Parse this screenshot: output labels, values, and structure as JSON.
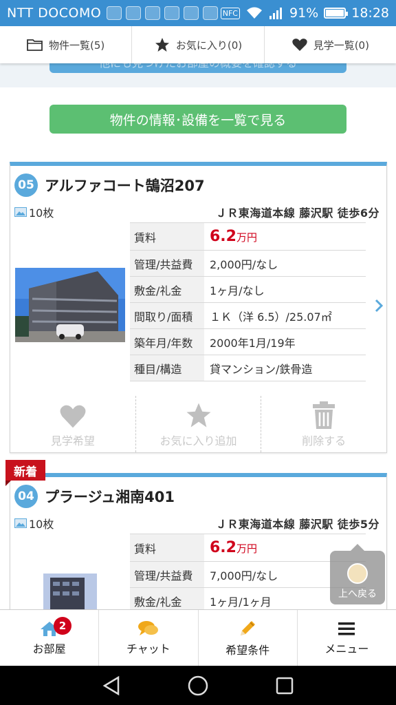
{
  "status_bar": {
    "carrier": "NTT DOCOMO",
    "nfc": "NFC",
    "battery": "91%",
    "battery_level": 0.91,
    "time": "18:28"
  },
  "tabs": [
    {
      "label": "物件一覧(5)",
      "icon": "folder-icon"
    },
    {
      "label": "お気に入り(0)",
      "icon": "star-icon"
    },
    {
      "label": "見学一覧(0)",
      "icon": "heart-icon"
    }
  ],
  "partial_button": "他にも見つけたお部屋の概要を確認する",
  "list_button": "物件の情報･設備を一覧で見る",
  "properties": [
    {
      "number": "05",
      "name": "アルファコート鵠沼207",
      "photos": "10枚",
      "station": "ＪＲ東海道本線 藤沢駅 徒歩6分",
      "rows": [
        {
          "key": "賃料",
          "price": "6.2",
          "unit": "万円"
        },
        {
          "key": "管理/共益費",
          "value": "2,000円/なし"
        },
        {
          "key": "敷金/礼金",
          "value": "1ヶ月/なし"
        },
        {
          "key": "間取り/面積",
          "value": "１Ｋ（洋 6.5）/25.07㎡"
        },
        {
          "key": "築年月/年数",
          "value": "2000年1月/19年"
        },
        {
          "key": "種目/構造",
          "value": "貸マンション/鉄骨造"
        }
      ],
      "actions": [
        "見学希望",
        "お気に入り追加",
        "削除する"
      ]
    },
    {
      "number": "04",
      "name": "プラージュ湘南401",
      "photos": "10枚",
      "station": "ＪＲ東海道本線 藤沢駅 徒歩5分",
      "badge": "新着",
      "rows": [
        {
          "key": "賃料",
          "price": "6.2",
          "unit": "万円"
        },
        {
          "key": "管理/共益費",
          "value": "7,000円/なし"
        },
        {
          "key": "敷金/礼金",
          "value": "1ヶ月/1ヶ月"
        }
      ]
    }
  ],
  "to_top": "上へ戻る",
  "bottom_nav": [
    {
      "label": "お部屋",
      "icon": "house-icon",
      "badge": "2"
    },
    {
      "label": "チャット",
      "icon": "chat-icon"
    },
    {
      "label": "希望条件",
      "icon": "pencil-icon"
    },
    {
      "label": "メニュー",
      "icon": "hamburger-icon"
    }
  ],
  "colors": {
    "accent": "#3a8fd1",
    "green": "#5cbf72",
    "price": "#d0021b",
    "new_badge": "#c8121d"
  }
}
